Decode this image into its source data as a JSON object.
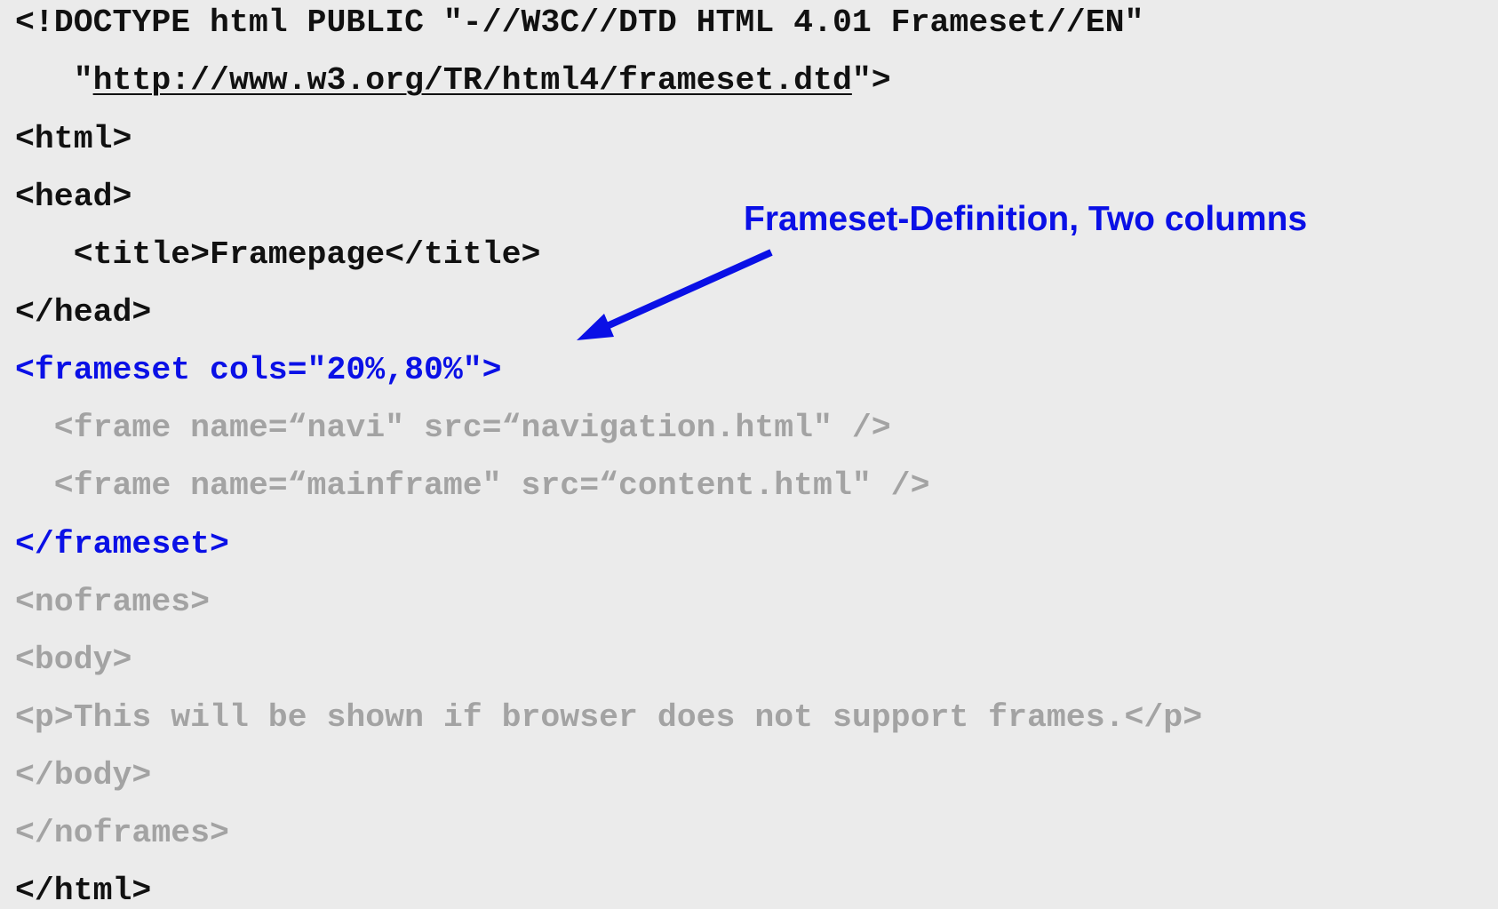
{
  "colors": {
    "background": "#ebebeb",
    "code_default": "#111111",
    "highlight_blue": "#0a10e6",
    "dimmed_gray": "#a3a3a3"
  },
  "code": {
    "doctype_line1": "<!DOCTYPE html PUBLIC \"-//W3C//DTD HTML 4.01 Frameset//EN\"",
    "doctype_line2_prefix": "   \"",
    "doctype_url": "http://www.w3.org/TR/html4/frameset.dtd",
    "doctype_line2_suffix": "\">",
    "html_open": "<html>",
    "head_open": "<head>",
    "title_line": "   <title>Framepage</title>",
    "head_close": "</head>",
    "frameset_open": "<frameset cols=\"20%,80%\">",
    "frame_navi": "  <frame name=“navi\" src=“navigation.html\" />",
    "frame_main": "  <frame name=“mainframe\" src=“content.html\" />",
    "frameset_close": "</frameset>",
    "noframes_open": "<noframes>",
    "body_open": "<body>",
    "p_line": "<p>This will be shown if browser does not support frames.</p>",
    "body_close": "</body>",
    "noframes_close": "</noframes>",
    "html_close": "</html>"
  },
  "annotation": {
    "label": "Frameset-Definition, Two columns",
    "icon": "arrow-down-left-icon"
  }
}
